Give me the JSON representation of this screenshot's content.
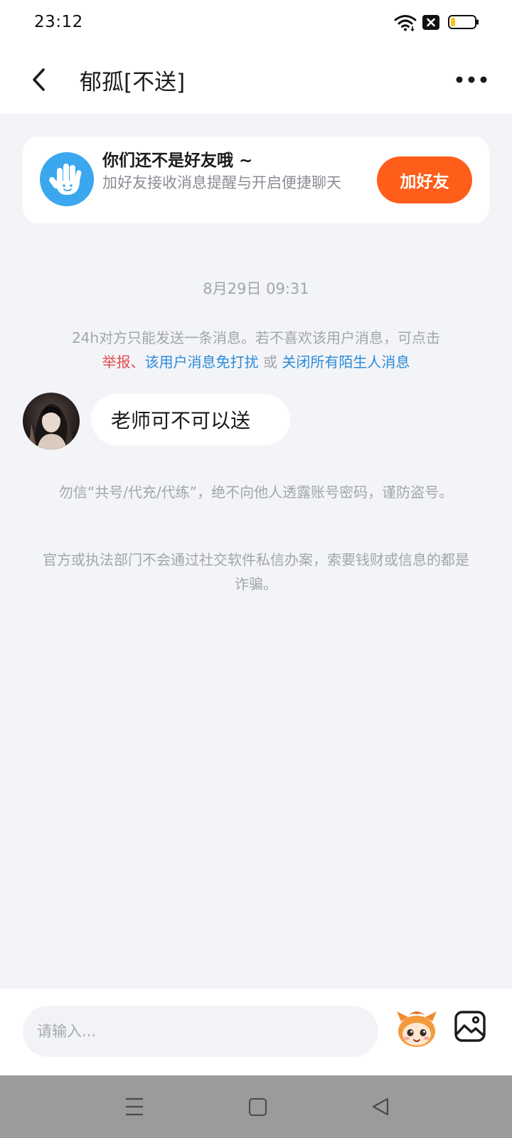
{
  "status_bar": {
    "time": "23:12",
    "icons": [
      "wifi-icon",
      "close-badge-icon",
      "battery-icon"
    ],
    "battery_level": 0.2,
    "battery_color": "#f7c21a"
  },
  "header": {
    "title": "郁孤[不送]",
    "back_icon": "back-icon",
    "more_icon": "more-icon"
  },
  "friend_card": {
    "title": "你们还不是好友哦 ~",
    "description": "加好友接收消息提醒与开启便捷聊天",
    "button_label": "加好友",
    "button_color": "#ff5e1a",
    "icon": "hand-icon",
    "icon_color": "#3aa7ee"
  },
  "chat": {
    "timestamp": "8月29日 09:31",
    "notice": {
      "text": "24h对方只能发送一条消息。若不喜欢该用户消息，可点击",
      "report_link": "举报",
      "separator": "、",
      "mute_link": "该用户消息免打扰",
      "or": " 或 ",
      "close_link": "关闭所有陌生人消息",
      "link_color": "#2a8ad9",
      "report_color": "#e34b4b"
    },
    "messages": [
      {
        "sender": "other",
        "text": "老师可不可以送",
        "avatar": "avatar"
      }
    ],
    "tips": [
      "勿信“共号/代充/代练”，绝不向他人透露账号密码，谨防盗号。",
      "官方或执法部门不会通过社交软件私信办案，索要钱财或信息的都是诈骗。"
    ]
  },
  "input_bar": {
    "placeholder": "请输入...",
    "value": "",
    "emoji_icon": "emoji-mascot-icon",
    "image_icon": "image-picker-icon"
  },
  "nav_bar": {
    "icons": [
      "nav-menu-icon",
      "nav-home-icon",
      "nav-back-icon"
    ]
  }
}
